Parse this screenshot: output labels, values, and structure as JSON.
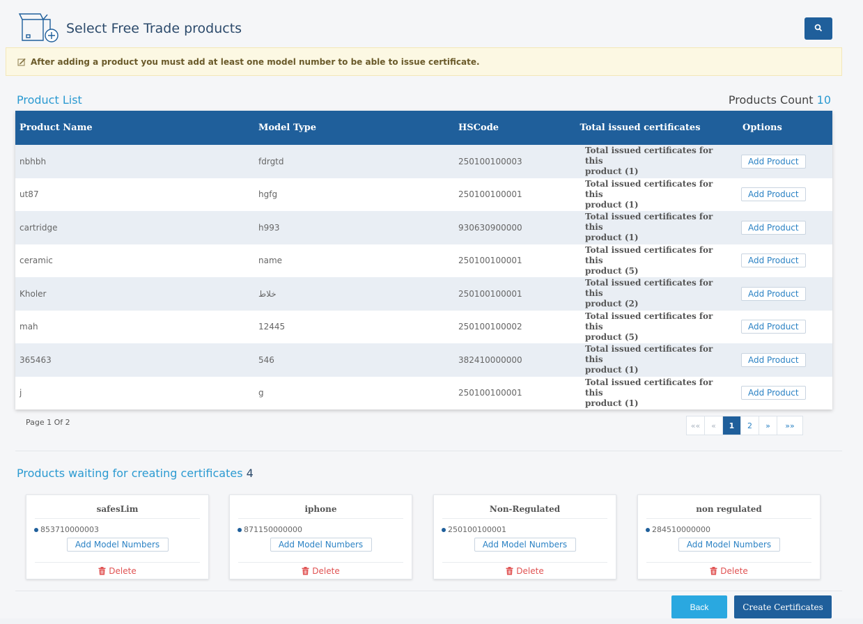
{
  "header": {
    "title": "Select Free Trade products",
    "icon": "box-plus-icon",
    "search_icon": "search-icon"
  },
  "alert": {
    "text": "After adding a product you must add at least one model number to be able to issue certificate.",
    "icon": "edit-icon"
  },
  "product_list": {
    "title": "Product List",
    "count_label": "Products Count",
    "count_value": "10",
    "columns": [
      "Product Name",
      "Model Type",
      "HSCode",
      "Total issued certificates",
      "Options"
    ],
    "rows": [
      {
        "name": "nbhbh",
        "model": "fdrgtd",
        "hscode": "250100100003",
        "certs_line1": "Total issued certificates for this",
        "certs_line2": "product (1)",
        "action": "Add Product"
      },
      {
        "name": "ut87",
        "model": "hgfg",
        "hscode": "250100100001",
        "certs_line1": "Total issued certificates for this",
        "certs_line2": "product (1)",
        "action": "Add Product"
      },
      {
        "name": "cartridge",
        "model": "h993",
        "hscode": "930630900000",
        "certs_line1": "Total issued certificates for this",
        "certs_line2": "product (1)",
        "action": "Add Product"
      },
      {
        "name": "ceramic",
        "model": "name",
        "hscode": "250100100001",
        "certs_line1": "Total issued certificates for this",
        "certs_line2": "product (5)",
        "action": "Add Product"
      },
      {
        "name": "Kholer",
        "model": "خلاط",
        "hscode": "250100100001",
        "certs_line1": "Total issued certificates for this",
        "certs_line2": "product (2)",
        "action": "Add Product"
      },
      {
        "name": "mah",
        "model": "12445",
        "hscode": "250100100002",
        "certs_line1": "Total issued certificates for this",
        "certs_line2": "product (5)",
        "action": "Add Product"
      },
      {
        "name": "365463",
        "model": "546",
        "hscode": "382410000000",
        "certs_line1": "Total issued certificates for this",
        "certs_line2": "product (1)",
        "action": "Add Product"
      },
      {
        "name": "j",
        "model": "g",
        "hscode": "250100100001",
        "certs_line1": "Total issued certificates for this",
        "certs_line2": "product (1)",
        "action": "Add Product"
      }
    ],
    "page_label": "Page 1 Of 2",
    "pagination": {
      "first": "««",
      "prev": "«",
      "pages": [
        "1",
        "2"
      ],
      "current": "1",
      "next": "»",
      "last": "»»"
    }
  },
  "waiting": {
    "title": "Products waiting for creating certificates",
    "count": "4",
    "cards": [
      {
        "title": "safesLim",
        "hscode": "853710000003",
        "add_label": "Add Model Numbers",
        "delete_label": "Delete"
      },
      {
        "title": "iphone",
        "hscode": "871150000000",
        "add_label": "Add Model Numbers",
        "delete_label": "Delete"
      },
      {
        "title": "Non-Regulated",
        "hscode": "250100100001",
        "add_label": "Add Model Numbers",
        "delete_label": "Delete"
      },
      {
        "title": "non regulated",
        "hscode": "284510000000",
        "add_label": "Add Model Numbers",
        "delete_label": "Delete"
      }
    ]
  },
  "footer": {
    "back_label": "Back",
    "create_label": "Create Certificates"
  },
  "colors": {
    "primary": "#1f5f9b",
    "accent": "#2b9ad1",
    "danger": "#e05252",
    "alert_bg": "#fcf8e3"
  }
}
